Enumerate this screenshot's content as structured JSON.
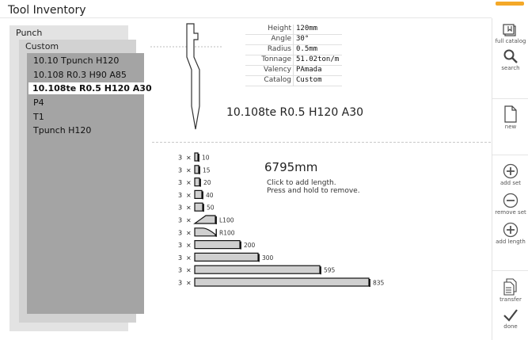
{
  "window": {
    "title": "Tool Inventory",
    "accent_color": "#f4a828"
  },
  "tree": {
    "root_label": "Punch",
    "group_label": "Custom",
    "items": [
      {
        "label": "10.10 Tpunch H120",
        "selected": false
      },
      {
        "label": "10.108 R0.3 H90 A85",
        "selected": false
      },
      {
        "label": "10.108te R0.5 H120 A30",
        "selected": true
      },
      {
        "label": "P4",
        "selected": false
      },
      {
        "label": "T1",
        "selected": false
      },
      {
        "label": "Tpunch H120",
        "selected": false
      }
    ]
  },
  "specs": [
    {
      "key": "Height",
      "value": "120mm"
    },
    {
      "key": "Angle",
      "value": "30°"
    },
    {
      "key": "Radius",
      "value": "0.5mm"
    },
    {
      "key": "Tonnage",
      "value": "51.02ton/m"
    },
    {
      "key": "Valency",
      "value": "PAmada"
    },
    {
      "key": "Catalog",
      "value": "Custom"
    }
  ],
  "tool_name": "10.108te R0.5 H120 A30",
  "sections": {
    "total_length": "6795mm",
    "hint_line1": "Click to add length.",
    "hint_line2": "Press and hold to remove.",
    "items": [
      {
        "count": "3",
        "times": "×",
        "length": "10",
        "kind": "plain"
      },
      {
        "count": "3",
        "times": "×",
        "length": "15",
        "kind": "plain"
      },
      {
        "count": "3",
        "times": "×",
        "length": "20",
        "kind": "plain"
      },
      {
        "count": "3",
        "times": "×",
        "length": "40",
        "kind": "plain"
      },
      {
        "count": "3",
        "times": "×",
        "length": "50",
        "kind": "plain"
      },
      {
        "count": "3",
        "times": "×",
        "length": "L100",
        "kind": "horn-left"
      },
      {
        "count": "3",
        "times": "×",
        "length": "R100",
        "kind": "horn-right"
      },
      {
        "count": "3",
        "times": "×",
        "length": "200",
        "kind": "plain"
      },
      {
        "count": "3",
        "times": "×",
        "length": "300",
        "kind": "plain"
      },
      {
        "count": "3",
        "times": "×",
        "length": "595",
        "kind": "plain"
      },
      {
        "count": "3",
        "times": "×",
        "length": "835",
        "kind": "plain"
      }
    ]
  },
  "toolbar": {
    "full_catalog": "full catalog",
    "search": "search",
    "new": "new",
    "add_set": "add set",
    "remove_set": "remove set",
    "add_length": "add length",
    "transfer": "transfer",
    "done": "done"
  }
}
